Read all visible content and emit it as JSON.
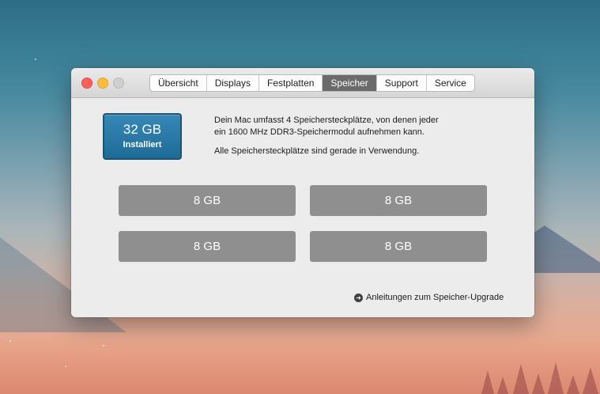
{
  "window": {
    "tabs": [
      {
        "label": "Übersicht",
        "active": false
      },
      {
        "label": "Displays",
        "active": false
      },
      {
        "label": "Festplatten",
        "active": false
      },
      {
        "label": "Speicher",
        "active": true
      },
      {
        "label": "Support",
        "active": false
      },
      {
        "label": "Service",
        "active": false
      }
    ]
  },
  "memory": {
    "installed_size": "32 GB",
    "installed_label": "Installiert",
    "description_line1": "Dein Mac umfasst 4 Speichersteckplätze, von denen jeder",
    "description_line2": "ein 1600 MHz DDR3-Speichermodul aufnehmen kann.",
    "status": "Alle Speichersteckplätze sind gerade in Verwendung.",
    "slots": [
      "8 GB",
      "8 GB",
      "8 GB",
      "8 GB"
    ],
    "upgrade_link": "Anleitungen zum Speicher-Upgrade",
    "upgrade_icon": "arrow-circle-icon"
  },
  "colors": {
    "accent": "#2a7aab",
    "slot": "#8f8f8f",
    "active_tab": "#6b6b6b"
  }
}
